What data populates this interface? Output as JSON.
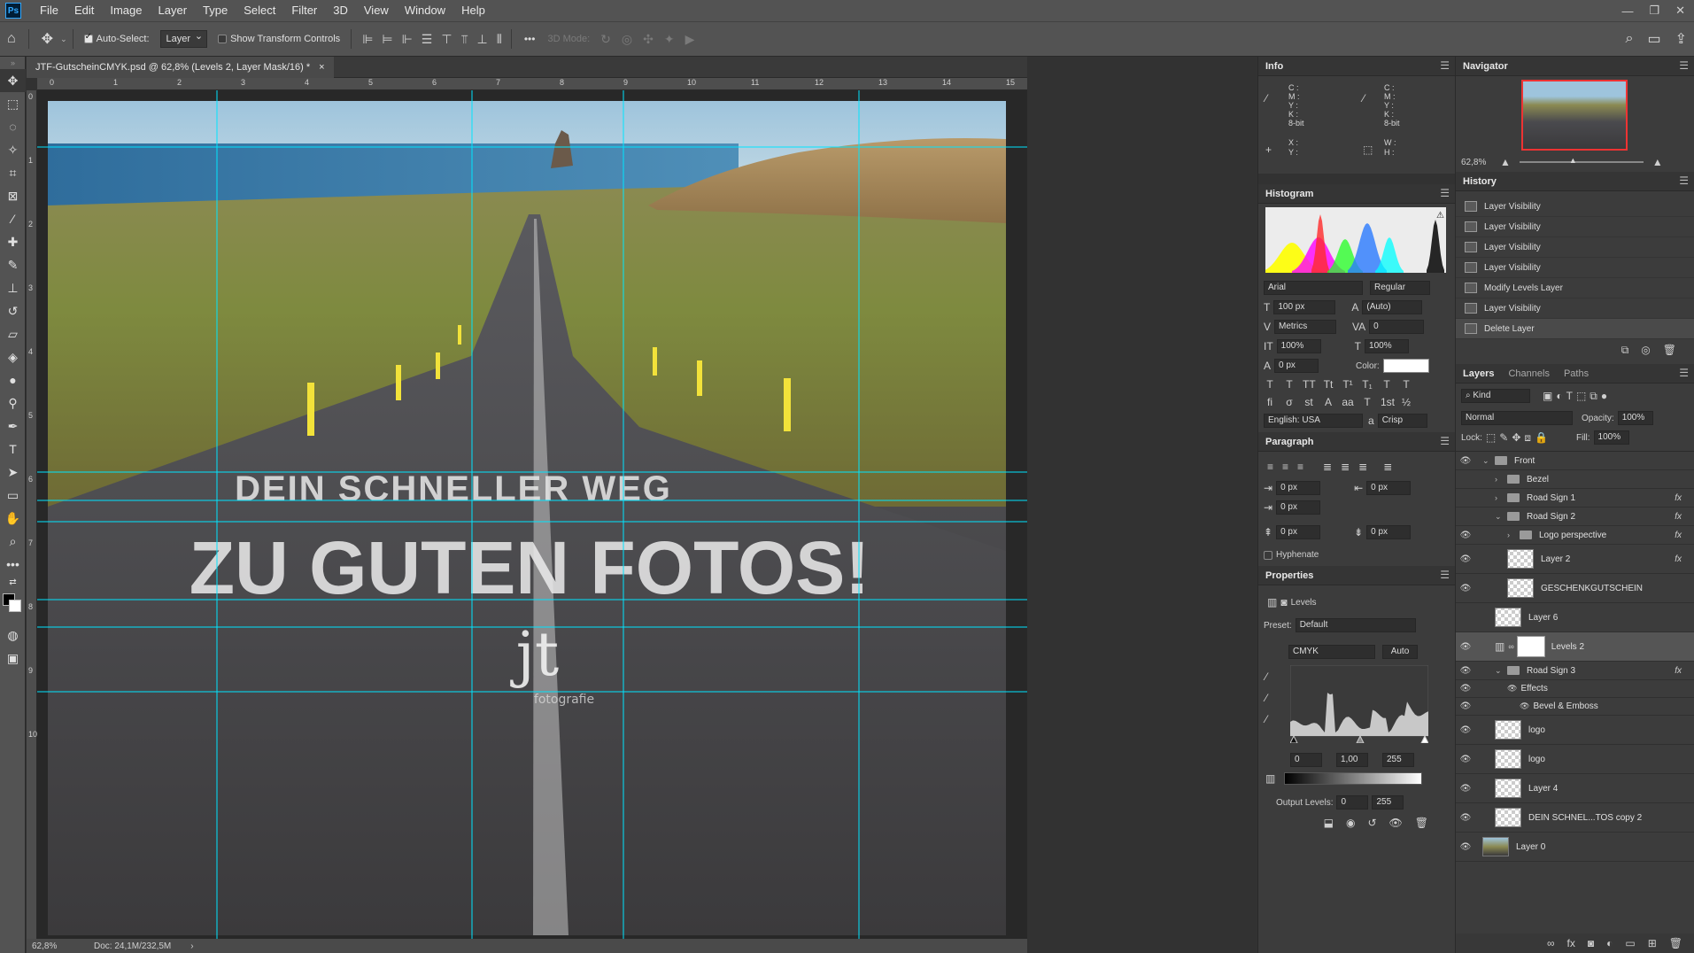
{
  "menu": [
    "File",
    "Edit",
    "Image",
    "Layer",
    "Type",
    "Select",
    "Filter",
    "3D",
    "View",
    "Window",
    "Help"
  ],
  "app_logo": "Ps",
  "options_bar": {
    "auto_select_label": "Auto-Select:",
    "auto_select_value": "Layer",
    "transform_controls_label": "Show Transform Controls",
    "mode_3d_label": "3D Mode:",
    "more_label": "•••"
  },
  "document": {
    "tab_title": "JTF-GutscheinCMYK.psd @ 62,8% (Levels 2, Layer Mask/16) *",
    "close_glyph": "×",
    "ruler_top": [
      "0",
      "1",
      "2",
      "3",
      "4",
      "5",
      "6",
      "7",
      "8",
      "9",
      "10",
      "11",
      "12",
      "13",
      "14",
      "15"
    ],
    "ruler_left": [
      "0",
      "1",
      "2",
      "3",
      "4",
      "5",
      "6",
      "7",
      "8",
      "9",
      "10"
    ],
    "headline_1": "DEIN SCHNELLER WEG",
    "headline_2": "ZU GUTEN FOTOS!",
    "logo_mark": "jt",
    "logo_sub": "fotografie"
  },
  "status": {
    "zoom": "62,8%",
    "doc_size": "Doc: 24,1M/232,5M",
    "arrow": "›"
  },
  "info_panel": {
    "title": "Info",
    "cmyk_labels": [
      "C :",
      "M :",
      "Y :",
      "K :"
    ],
    "bit_label": "8-bit",
    "xy_labels": [
      "X :",
      "Y :"
    ],
    "wh_labels": [
      "W :",
      "H :"
    ]
  },
  "histogram_panel": {
    "title": "Histogram"
  },
  "character_panel": {
    "font_family": "Arial",
    "font_style": "Regular",
    "font_size": "100 px",
    "leading": "(Auto)",
    "kerning": "Metrics",
    "tracking": "0",
    "vertical_scale": "100%",
    "horizontal_scale": "100%",
    "baseline_shift": "0 px",
    "color_label": "Color:",
    "language": "English: USA",
    "antialias": "Crisp",
    "style_buttons": [
      "T",
      "T",
      "TT",
      "Tt",
      "T¹",
      "T₁",
      "T",
      "T"
    ],
    "opentype_buttons": [
      "fi",
      "σ",
      "st",
      "A",
      "aa",
      "T",
      "1st",
      "½"
    ]
  },
  "paragraph_panel": {
    "title": "Paragraph",
    "indent_left": "0 px",
    "indent_right": "0 px",
    "indent_first": "0 px",
    "space_before": "0 px",
    "space_after": "0 px",
    "hyphenate_label": "Hyphenate"
  },
  "properties_panel": {
    "title": "Properties",
    "adjustment_label": "Levels",
    "preset_label": "Preset:",
    "preset_value": "Default",
    "channel": "CMYK",
    "auto_label": "Auto",
    "input_black": "0",
    "input_gamma": "1,00",
    "input_white": "255",
    "output_label": "Output Levels:",
    "output_black": "0",
    "output_white": "255"
  },
  "navigator_panel": {
    "title": "Navigator",
    "zoom": "62,8%"
  },
  "history_panel": {
    "title": "History",
    "items": [
      "Layer Visibility",
      "Layer Visibility",
      "Layer Visibility",
      "Layer Visibility",
      "Modify Levels Layer",
      "Layer Visibility",
      "Delete Layer"
    ]
  },
  "layers_panel": {
    "tabs": [
      "Layers",
      "Channels",
      "Paths"
    ],
    "filter_kind": "Kind",
    "blend_mode": "Normal",
    "opacity_label": "Opacity:",
    "opacity_value": "100%",
    "lock_label": "Lock:",
    "fill_label": "Fill:",
    "fill_value": "100%",
    "fx_label": "fx",
    "layers": [
      {
        "name": "Front",
        "type": "group",
        "visible": true,
        "indent": 0,
        "open": true,
        "fx": false
      },
      {
        "name": "Bezel",
        "type": "group",
        "visible": false,
        "indent": 1,
        "open": false,
        "fx": false
      },
      {
        "name": "Road Sign 1",
        "type": "group",
        "visible": false,
        "indent": 1,
        "open": false,
        "fx": true
      },
      {
        "name": "Road Sign 2",
        "type": "group",
        "visible": false,
        "indent": 1,
        "open": true,
        "fx": true
      },
      {
        "name": "Logo perspective",
        "type": "group",
        "visible": true,
        "indent": 2,
        "open": false,
        "fx": true
      },
      {
        "name": "Layer 2",
        "type": "layer",
        "visible": true,
        "indent": 2,
        "fx": true
      },
      {
        "name": "GESCHENKGUTSCHEIN",
        "type": "layer",
        "visible": true,
        "indent": 2,
        "fx": false
      },
      {
        "name": "Layer 6",
        "type": "layer",
        "visible": false,
        "indent": 1,
        "fx": false
      },
      {
        "name": "Levels 2",
        "type": "adjustment",
        "visible": true,
        "indent": 1,
        "fx": false,
        "selected": true
      },
      {
        "name": "Road Sign 3",
        "type": "group",
        "visible": true,
        "indent": 1,
        "open": true,
        "fx": true
      },
      {
        "name": "Effects",
        "type": "effect",
        "visible": true,
        "indent": 2,
        "fx": false
      },
      {
        "name": "Bevel & Emboss",
        "type": "effect",
        "visible": true,
        "indent": 3,
        "fx": false
      },
      {
        "name": "logo",
        "type": "layer",
        "visible": true,
        "indent": 1,
        "fx": false
      },
      {
        "name": "logo",
        "type": "layer",
        "visible": true,
        "indent": 1,
        "fx": false
      },
      {
        "name": "Layer 4",
        "type": "layer",
        "visible": true,
        "indent": 1,
        "fx": false
      },
      {
        "name": "DEIN SCHNEL...TOS copy 2",
        "type": "layer",
        "visible": true,
        "indent": 1,
        "fx": false
      },
      {
        "name": "Layer 0",
        "type": "photo",
        "visible": true,
        "indent": 0,
        "fx": false
      }
    ]
  },
  "colors": {
    "guide": "#00e5ff",
    "histogram_red": "#ff2a2a",
    "histogram_green": "#22ff22",
    "histogram_blue": "#2a7bff",
    "histogram_yellow": "#ffff00",
    "histogram_magenta": "#ff00ff",
    "histogram_cyan": "#00ffff"
  }
}
